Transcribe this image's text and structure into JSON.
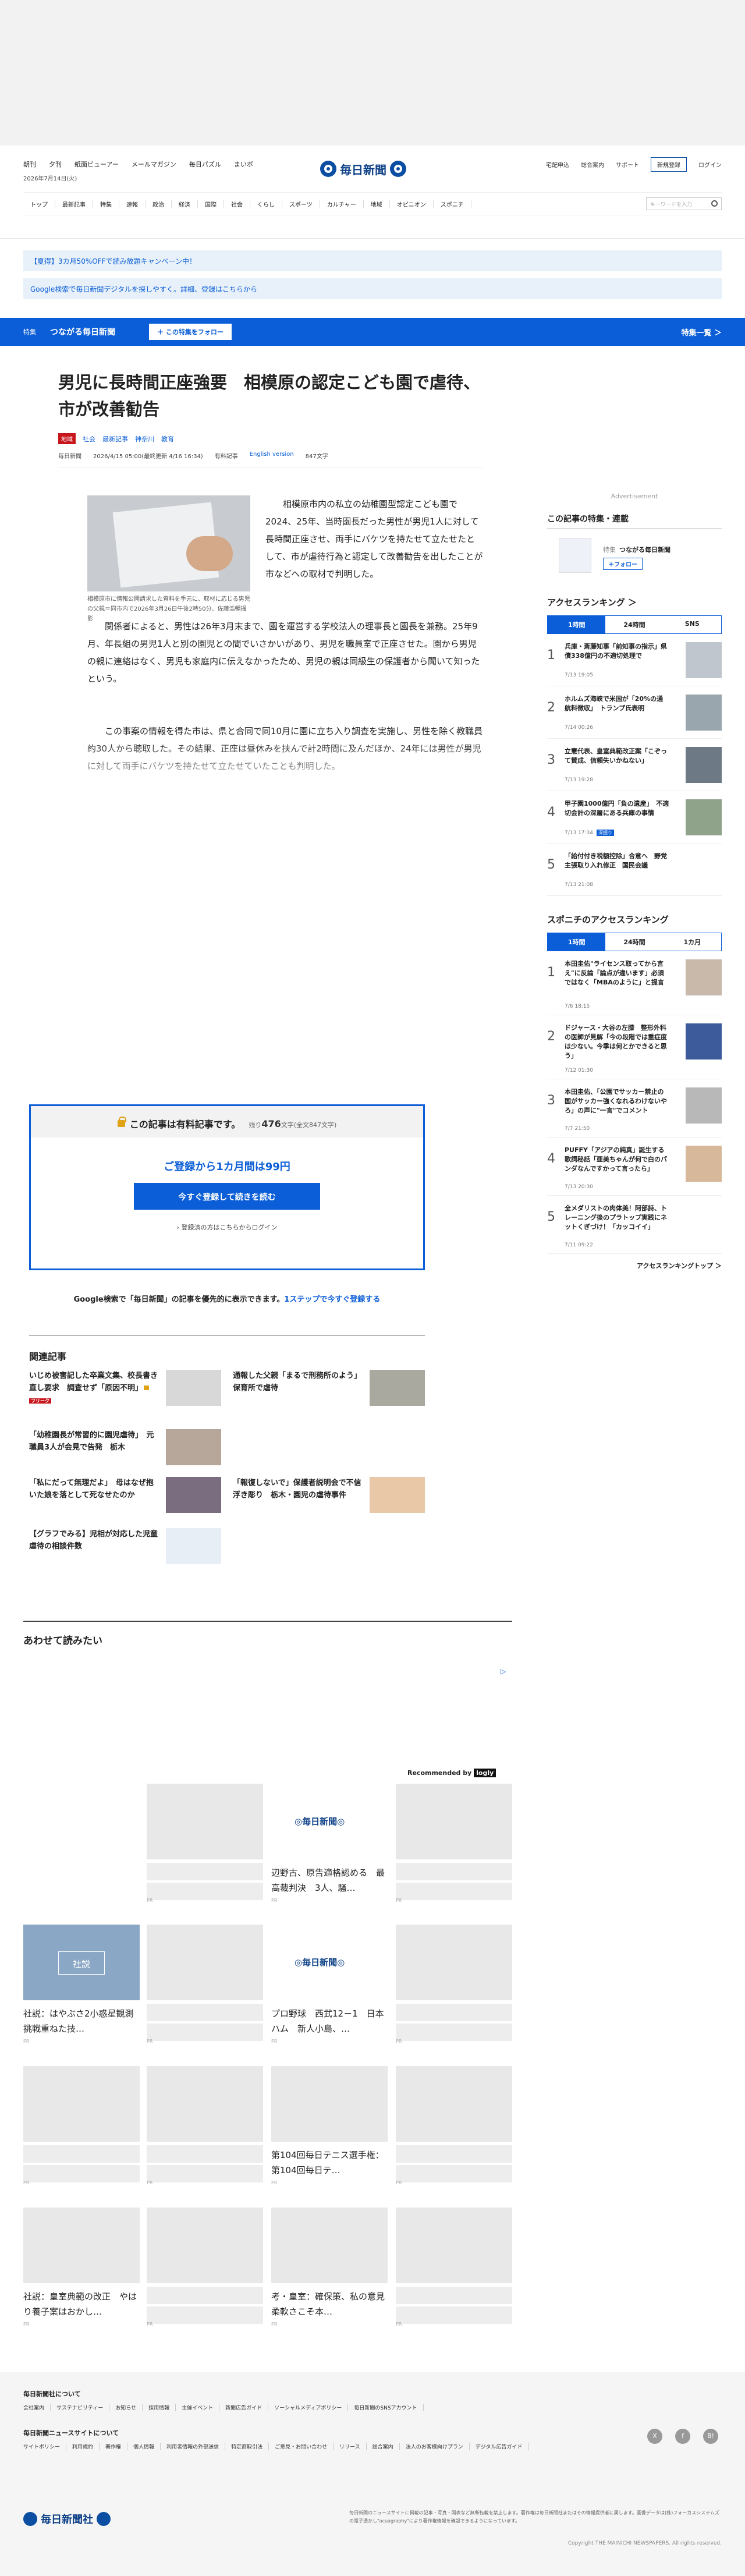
{
  "header": {
    "top_links": [
      "朝刊",
      "夕刊",
      "紙面ビューアー",
      "メールマガジン",
      "毎日パズル",
      "まいボ"
    ],
    "logo_text": "毎日新聞",
    "right_links": [
      "宅配申込",
      "総合案内",
      "サポート"
    ],
    "register_label": "新規登録",
    "login_label": "ログイン",
    "date": "2026年7月14日(火)",
    "nav": [
      "トップ",
      "最新記事",
      "特集",
      "速報",
      "政治",
      "経済",
      "国際",
      "社会",
      "くらし",
      "スポーツ",
      "カルチャー",
      "地域",
      "オピニオン",
      "スポニチ"
    ],
    "search_placeholder": "キーワードを入力"
  },
  "banners": {
    "b1": "【夏得】3カ月50%OFFで読み放題キャンペーン中！",
    "b2": "Google検索で毎日新聞デジタルを探しやすく。詳細、登録はこちらから"
  },
  "feature_bar": {
    "tag": "特集",
    "title": "つながる毎日新聞",
    "follow": "＋ この特集をフォロー",
    "list": "特集一覧 ＞"
  },
  "article": {
    "title": "男児に長時間正座強要　相模原の認定こども園で虐待、市が改善勧告",
    "tag_red": "地域",
    "tags": [
      "社会",
      "最新記事",
      "神奈川",
      "教育"
    ],
    "source": "毎日新聞",
    "date": "2026/4/15 05:00(最終更新 4/16 16:34)",
    "premium": "有料記事",
    "english": "English version",
    "chars": "847文字",
    "caption": "相模原市に情報公開請求した資料を手元に、取材に応じる男児の父親＝同市内で2026年3月26日午後2時50分、佐藤浩暢撮影",
    "p1": "相模原市内の私立の幼稚園型認定こども園で2024、25年、当時園長だった男性が男児1人に対して長時間正座させ、両手にバケツを持たせて立たせたとして、市が虐待行為と認定して改善勧告を出したことが市などへの取材で判明した。",
    "p2": "関係者によると、男性は26年3月末まで、園を運営する学校法人の理事長と園長を兼務。25年9月、年長組の男児1人と別の園児との間でいさかいがあり、男児を職員室で正座させた。園から男児の親に連絡はなく、男児も家庭内に伝えなかったため、男児の親は同級生の保護者から聞いて知ったという。",
    "p3": "この事案の情報を得た市は、県と合同で同10月に園に立ち入り調査を実施し、男性を除く教職員約30人から聴取した。その結果、正座は昼休みを挟んで計2時間に及んだほか、24年には男性が男児に対して両手にバケツを持たせて立たせていたことも判明した。"
  },
  "paywall": {
    "title": "この記事は有料記事です。",
    "remain_prefix": "残り",
    "remain_num": "476",
    "remain_suffix": "文字(全文847文字)",
    "price": "ご登録から1カ月間は99円",
    "button": "今すぐ登録して続きを読む",
    "login": "› 登録済の方はこちらからログイン"
  },
  "google_note": {
    "text": "Google検索で「毎日新聞」の記事を優先的に表示できます。",
    "link": "1ステップで今すぐ登録する"
  },
  "related": {
    "heading": "関連記事",
    "items": [
      {
        "title": "いじめ被害記した卒業文集、校長書き直し要求　調査せず「原因不明」",
        "badge": "フリーク"
      },
      {
        "title": "通報した父親「まるで刑務所のよう」　保育所で虐待"
      },
      {
        "title": "「幼稚園長が常習的に園児虐待」　元職員3人が会見で告発　栃木"
      },
      {
        "title": "「私にだって無理だよ」　母はなぜ抱いた娘を落として死なせたのか"
      },
      {
        "title": "「報復しないで」保護者説明会で不信浮き彫り　栃木・園児の虐待事件"
      },
      {
        "title": "【グラフでみる】児相が対応した児童虐待の相談件数"
      }
    ]
  },
  "sidebar": {
    "ad_label": "Advertisement",
    "feature_heading": "この記事の特集・連載",
    "feature_tag": "特集",
    "feature_title": "つながる毎日新聞",
    "feature_follow": "＋フォロー",
    "ranking_heading": "アクセスランキング ＞",
    "ranking_tabs": [
      "1時間",
      "24時間",
      "SNS"
    ],
    "ranking": [
      {
        "n": "1",
        "t": "兵庫・斎藤知事「前知事の指示」県債338億円の不適切処理で",
        "d": "7/13 19:05"
      },
      {
        "n": "2",
        "t": "ホルムズ海峡で米国が「20%の通航料徴収」　トランプ氏表明",
        "d": "7/14 00:26"
      },
      {
        "n": "3",
        "t": "立憲代表、皇室典範改正案「こぞって賛成、信頼失いかねない」",
        "d": "7/13 19:28"
      },
      {
        "n": "4",
        "t": "甲子園1000億円「負の遺産」　不適切会計の深層にある兵庫の事情",
        "d": "7/13 17:34",
        "tag": "深掘り"
      },
      {
        "n": "5",
        "t": "「給付付き税額控除」合意へ　野党主張取り入れ修正　国民会議",
        "d": "7/13 21:08"
      }
    ],
    "sponichi_heading": "スポニチのアクセスランキング",
    "sponichi_tabs": [
      "1時間",
      "24時間",
      "1カ月"
    ],
    "sponichi": [
      {
        "n": "1",
        "t": "本田圭佑\"ライセンス取ってから言え\"に反論「論点が違います」必須ではなく「MBAのように」と提言",
        "d": "7/6 18:15"
      },
      {
        "n": "2",
        "t": "ドジャース・大谷の左膝　整形外科の医師が見解「今の段階では重症度は少ない。今季は何とかできると思う」",
        "d": "7/12 01:30"
      },
      {
        "n": "3",
        "t": "本田圭佑、「公園でサッカー禁止の国がサッカー強くなれるわけないやろ」の声に\"一言\"でコメント",
        "d": "7/7 21:50"
      },
      {
        "n": "4",
        "t": "PUFFY「アジアの純真」誕生する歌詞秘話「亜美ちゃんが何で白のパンダなんですかって言ったら」",
        "d": "7/13 20:30"
      },
      {
        "n": "5",
        "t": "全メダリストの肉体美！阿部詩、トレーニング後のプラトップ実践にネットくぎづけ！「カッコイイ」",
        "d": "7/11 09:22"
      }
    ],
    "ranking_top": "アクセスランキングトップ ＞"
  },
  "awase": {
    "heading": "あわせて読みたい",
    "rec_by": "Recommended by",
    "rec_brand": "logly",
    "pr": "PR",
    "cards": [
      {
        "title": "辺野古、原告適格認める　最高裁判決　3人、騒…"
      },
      {
        "title": "社説：はやぶさ2小惑星観測　挑戦重ねた技…",
        "img_text": "社説"
      },
      {
        "title": "プロ野球　西武12－1　日本ハム　新人小島、…"
      },
      {
        "title": "第104回毎日テニス選手権：第104回毎日テ…"
      },
      {
        "title": "社説：皇室典範の改正　やはり養子案はおかし…"
      },
      {
        "title": "考・皇室：確保策、私の意見　柔軟さこそ本…"
      }
    ]
  },
  "footer": {
    "about": "毎日新聞社について",
    "about_links": [
      "会社案内",
      "サステナビリティー",
      "お知らせ",
      "採用情報",
      "主催イベント",
      "新聞広告ガイド",
      "ソーシャルメディアポリシー",
      "毎日新聞のSNSアカウント"
    ],
    "site": "毎日新聞ニュースサイトについて",
    "site_links": [
      "サイトポリシー",
      "利用規約",
      "著作権",
      "個人情報",
      "利用者情報の外部送信",
      "特定商取引法",
      "ご意見・お問い合わせ",
      "リリース",
      "総合案内",
      "法人のお客様向けプラン",
      "デジタル広告ガイド"
    ],
    "social": [
      "X",
      "f",
      "B!"
    ],
    "logo": "毎日新聞社",
    "legal": "毎日新聞のニュースサイトに掲載の記事・写真・図表など無断転載を禁止します。著作権は毎日新聞社またはその情報提供者に属します。画像データは(株)フォーカスシステムズの電子透かし\"acuagraphy\"により著作権情報を確認できるようになっています。",
    "copyright": "Copyright THE MAINICHI NEWSPAPERS. All rights reserved."
  }
}
